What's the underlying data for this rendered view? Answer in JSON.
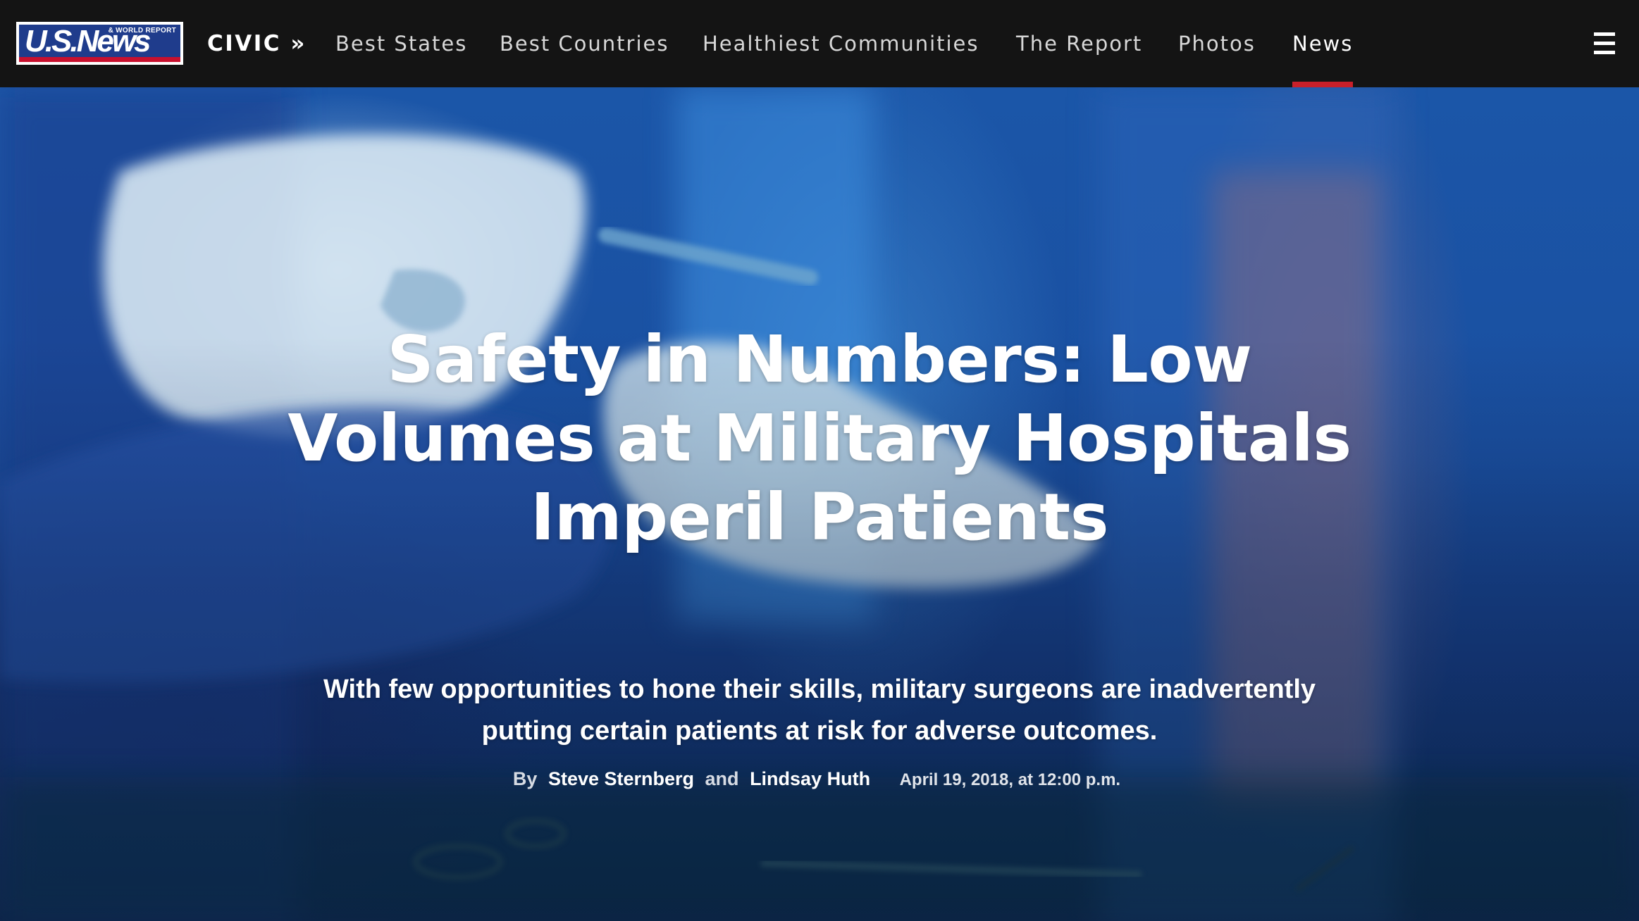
{
  "nav": {
    "logo": {
      "main": "U.S.News",
      "sub": "& WORLD REPORT"
    },
    "section": "CIVIC »",
    "items": [
      {
        "label": "Best States"
      },
      {
        "label": "Best Countries"
      },
      {
        "label": "Healthiest Communities"
      },
      {
        "label": "The Report"
      },
      {
        "label": "Photos"
      },
      {
        "label": "News",
        "active": true
      }
    ],
    "menu_icon": "hamburger-menu-icon",
    "active_color": "#c8202a"
  },
  "article": {
    "headline": "Safety in Numbers: Low Volumes at Military Hospitals Imperil Patients",
    "dek": "With few opportunities to hone their skills, military surgeons are inadvertently putting certain patients at risk for adverse outcomes.",
    "byline": {
      "prefix": "By",
      "author1": "Steve Sternberg",
      "joiner": "and",
      "author2": "Lindsay Huth",
      "date": "April 19, 2018, at 12:00 p.m."
    }
  }
}
